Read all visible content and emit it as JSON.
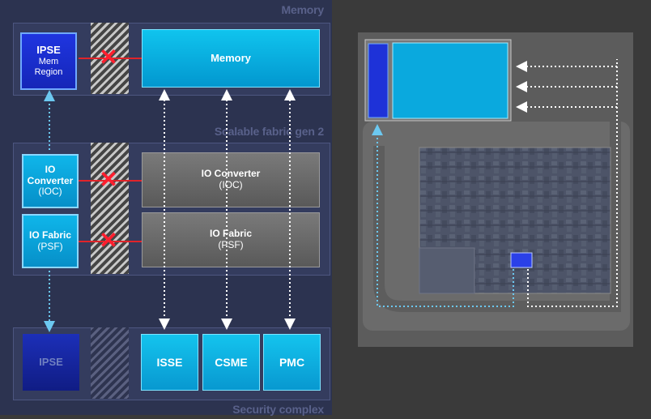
{
  "sections": {
    "memory_label": "Memory",
    "fabric_label": "Scalable fabric gen 2",
    "security_label": "Security complex"
  },
  "memory_row": {
    "ipse_title": "IPSE",
    "ipse_line2": "Mem",
    "ipse_line3": "Region",
    "memory_block": "Memory"
  },
  "fabric_row": {
    "ioc_side_line1": "IO",
    "ioc_side_line2": "Converter",
    "ioc_side_line3": "(IOC)",
    "psf_side_line1": "IO Fabric",
    "psf_side_line2": "(PSF)",
    "ioc_block_line1": "IO Converter",
    "ioc_block_line2": "(IOC)",
    "psf_block_line1": "IO Fabric",
    "psf_block_line2": "(PSF)"
  },
  "security_row": {
    "ipse": "IPSE",
    "isse": "ISSE",
    "csme": "CSME",
    "pmc": "PMC"
  },
  "blocked_marker": "✕",
  "colors": {
    "accent_cyan": "#0fb6ea",
    "ipse_blue": "#1f35e0",
    "blocked_red": "#e0242a",
    "arrow_cyan": "#6cc8f0",
    "arrow_white": "#ffffff"
  }
}
